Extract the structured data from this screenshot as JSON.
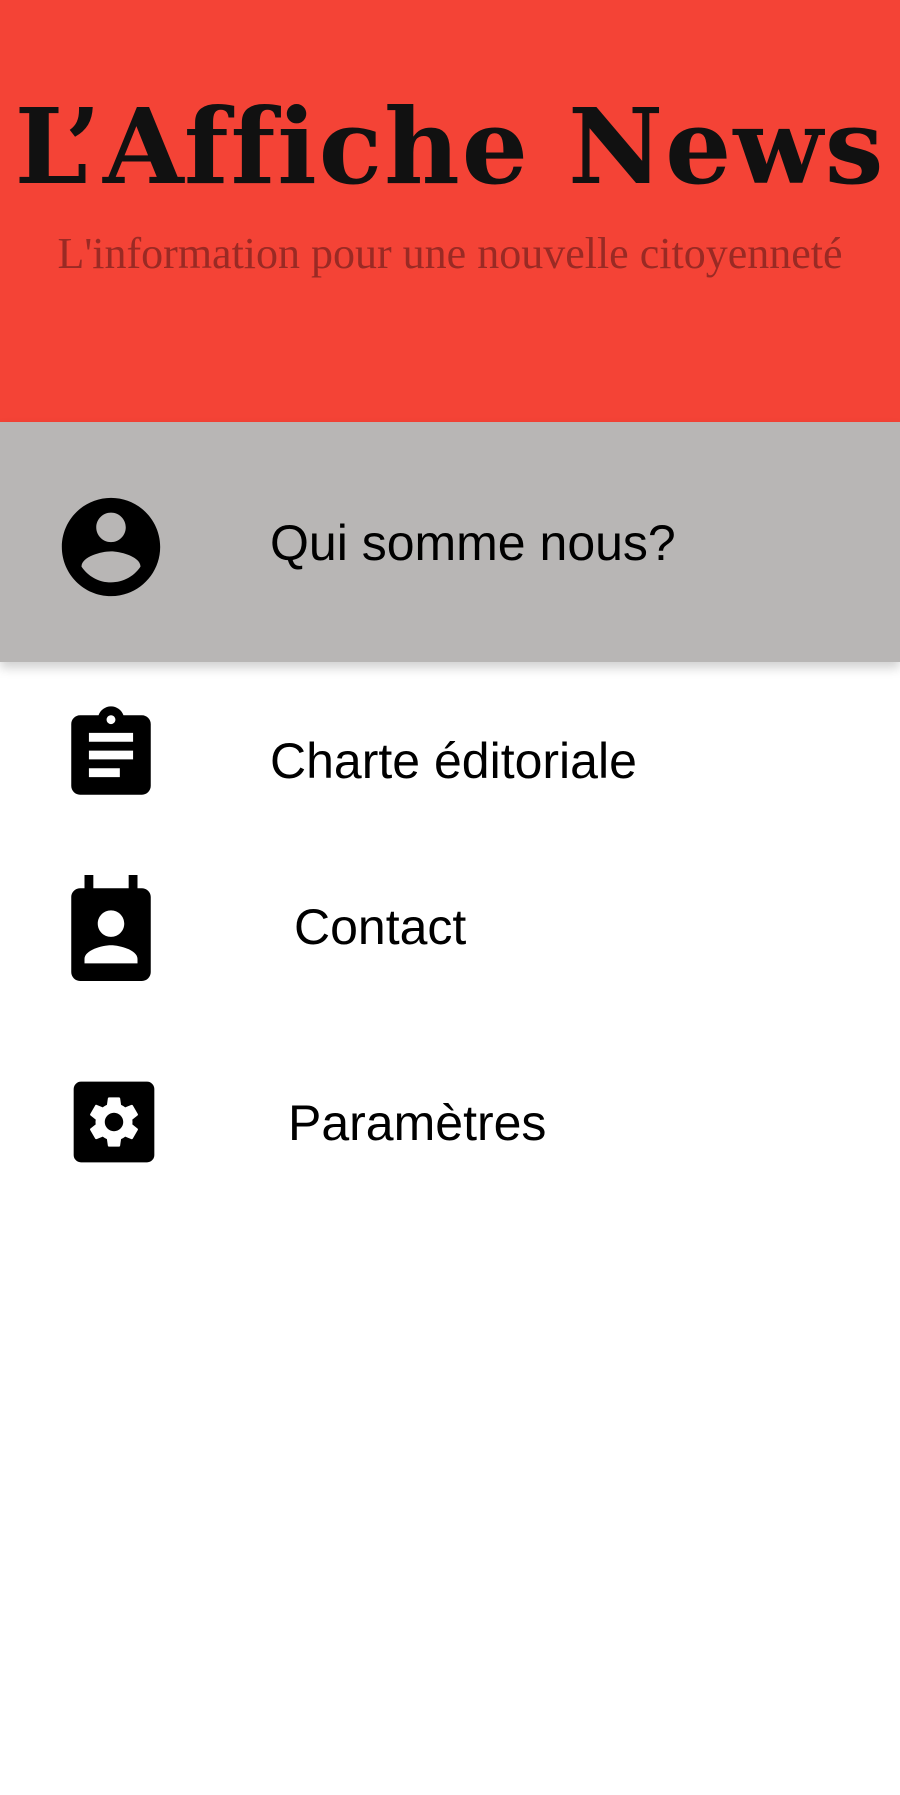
{
  "header": {
    "brand_title": "L’Affiche  News",
    "brand_tagline": "L'information pour une nouvelle citoyenneté",
    "background_color": "#f44336"
  },
  "menu": {
    "active_color": "#b8b6b5",
    "items": [
      {
        "label": "Qui somme nous?",
        "icon": "account-circle-icon",
        "active": true
      },
      {
        "label": "Charte éditoriale",
        "icon": "clipboard-icon",
        "active": false
      },
      {
        "label": "Contact",
        "icon": "contact-badge-icon",
        "active": false
      },
      {
        "label": "Paramètres",
        "icon": "settings-gear-icon",
        "active": false
      }
    ]
  }
}
